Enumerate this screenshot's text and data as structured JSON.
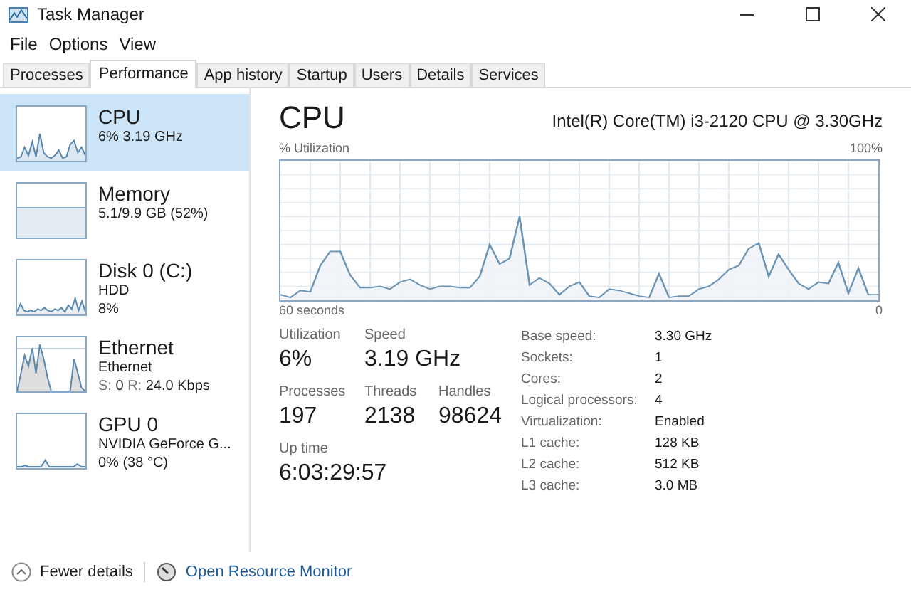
{
  "window": {
    "title": "Task Manager"
  },
  "menu": [
    "File",
    "Options",
    "View"
  ],
  "tabs": [
    {
      "label": "Processes",
      "selected": false
    },
    {
      "label": "Performance",
      "selected": true
    },
    {
      "label": "App history",
      "selected": false
    },
    {
      "label": "Startup",
      "selected": false
    },
    {
      "label": "Users",
      "selected": false
    },
    {
      "label": "Details",
      "selected": false
    },
    {
      "label": "Services",
      "selected": false
    }
  ],
  "sidebar": {
    "items": [
      {
        "kind": "cpu",
        "title": "CPU",
        "lines": [
          "6% 3.19 GHz"
        ],
        "selected": true
      },
      {
        "kind": "memory",
        "title": "Memory",
        "lines": [
          "5.1/9.9 GB (52%)"
        ],
        "selected": false
      },
      {
        "kind": "disk",
        "title": "Disk 0 (C:)",
        "lines": [
          "HDD",
          "8%"
        ],
        "selected": false
      },
      {
        "kind": "ethernet",
        "title": "Ethernet",
        "lines": [
          "Ethernet"
        ],
        "send_receive": {
          "s_label": "S:",
          "s_value": "0",
          "r_label": "R:",
          "r_value": "24.0 Kbps"
        },
        "selected": false
      },
      {
        "kind": "gpu",
        "title": "GPU 0",
        "lines": [
          "NVIDIA GeForce G...",
          "0% (38 °C)"
        ],
        "selected": false
      }
    ]
  },
  "detail": {
    "title": "CPU",
    "model": "Intel(R) Core(TM) i3-2120 CPU @ 3.30GHz",
    "graph": {
      "y_label": "% Utilization",
      "y_max": "100%",
      "x_label": "60 seconds",
      "x_min": "0"
    },
    "stats": [
      {
        "label": "Utilization",
        "value": "6%"
      },
      {
        "label": "Speed",
        "value": "3.19 GHz"
      },
      {
        "label": "Processes",
        "value": "197"
      },
      {
        "label": "Threads",
        "value": "2138"
      },
      {
        "label": "Handles",
        "value": "98624"
      },
      {
        "label": "Up time",
        "value": "6:03:29:57"
      }
    ],
    "properties": [
      {
        "label": "Base speed:",
        "value": "3.30 GHz"
      },
      {
        "label": "Sockets:",
        "value": "1"
      },
      {
        "label": "Cores:",
        "value": "2"
      },
      {
        "label": "Logical processors:",
        "value": "4"
      },
      {
        "label": "Virtualization:",
        "value": "Enabled"
      },
      {
        "label": "L1 cache:",
        "value": "128 KB"
      },
      {
        "label": "L2 cache:",
        "value": "512 KB"
      },
      {
        "label": "L3 cache:",
        "value": "3.0 MB"
      }
    ]
  },
  "footer": {
    "fewer_details": "Fewer details",
    "resource_monitor": "Open Resource Monitor"
  }
}
